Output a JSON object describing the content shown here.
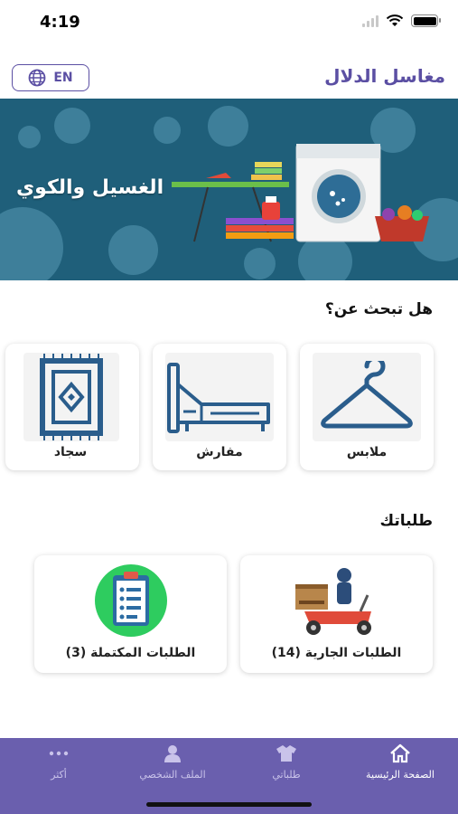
{
  "status_bar": {
    "time": "4:19"
  },
  "header": {
    "language_button": "EN",
    "app_title": "مغاسل الدلال"
  },
  "banner": {
    "text": "الغسيل والكوي"
  },
  "search_section": {
    "title": "هل تبحث عن؟",
    "categories": [
      {
        "label": "ملابس",
        "icon": "hanger-icon"
      },
      {
        "label": "مفارش",
        "icon": "bed-icon"
      },
      {
        "label": "سجاد",
        "icon": "carpet-icon"
      }
    ]
  },
  "orders_section": {
    "title": "طلباتك",
    "cards": [
      {
        "label": "الطلبات الجارية (14)",
        "icon": "delivery-scooter-icon"
      },
      {
        "label": "الطلبات المكتملة (3)",
        "icon": "clipboard-checklist-icon"
      }
    ]
  },
  "tab_bar": {
    "active": "home",
    "items": [
      {
        "label": "الصفحة الرئيسية",
        "icon": "home-icon"
      },
      {
        "label": "طلباتي",
        "icon": "tshirt-icon"
      },
      {
        "label": "الملف الشخصي",
        "icon": "user-icon"
      },
      {
        "label": "أكثر",
        "icon": "more-dots-icon"
      }
    ]
  },
  "colors": {
    "primary": "#5b4fa3",
    "tab_bar": "#6a5fae",
    "banner_bg": "#1f5f7a",
    "category_icon": "#2a5d8c"
  }
}
